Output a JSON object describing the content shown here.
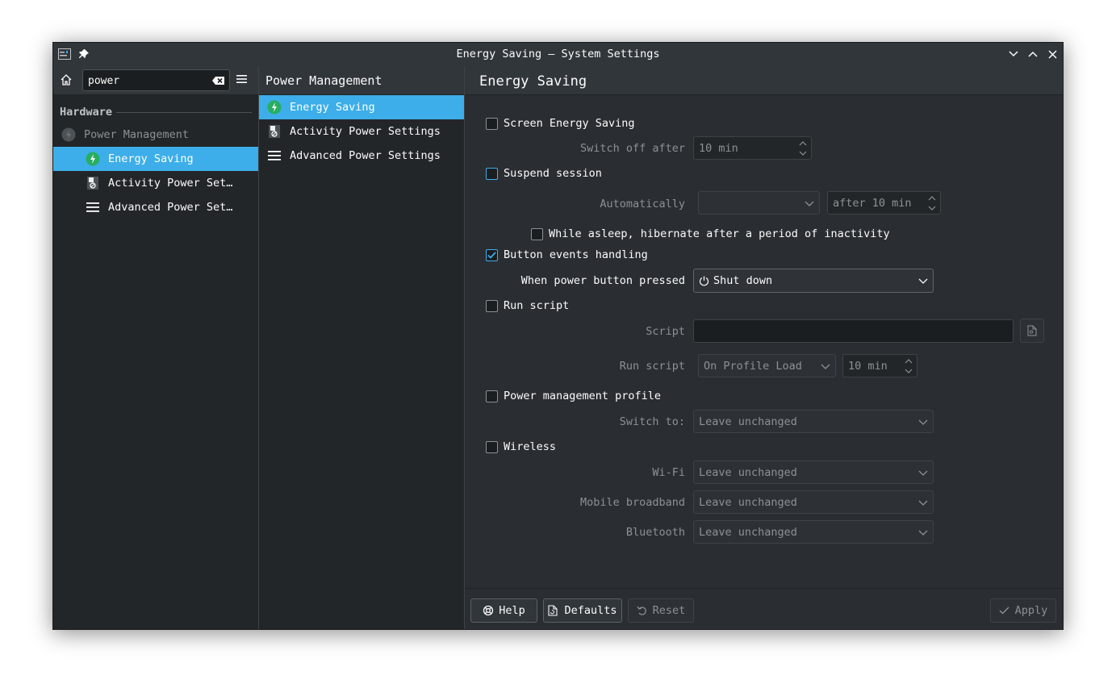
{
  "window": {
    "title": "Energy Saving — System Settings"
  },
  "sidebar": {
    "search_value": "power",
    "search_placeholder": "Search…",
    "section": "Hardware",
    "items": [
      {
        "label": "Power Management",
        "icon": "power-management-icon"
      },
      {
        "label": "Energy Saving",
        "icon": "energy-saving-icon",
        "selected": true
      },
      {
        "label": "Activity Power Set…",
        "icon": "activity-power-icon"
      },
      {
        "label": "Advanced Power Set…",
        "icon": "advanced-power-icon"
      }
    ]
  },
  "middle": {
    "title": "Power Management",
    "items": [
      {
        "label": "Energy Saving",
        "selected": true
      },
      {
        "label": "Activity Power Settings"
      },
      {
        "label": "Advanced Power Settings"
      }
    ]
  },
  "content": {
    "title": "Energy Saving",
    "screen_energy_saving": {
      "label": "Screen Energy Saving",
      "checked": false,
      "switch_off_label": "Switch off after",
      "switch_off_value": "10 min"
    },
    "suspend_session": {
      "label": "Suspend session",
      "checked": false,
      "automatically_label": "Automatically",
      "automatically_value": "",
      "after_value": "after 10 min",
      "hibernate_label": "While asleep, hibernate after a period of inactivity"
    },
    "button_events": {
      "label": "Button events handling",
      "checked": true,
      "power_button_label": "When power button pressed",
      "power_button_value": "Shut down"
    },
    "run_script": {
      "label": "Run script",
      "checked": false,
      "script_label": "Script",
      "script_value": "",
      "run_label": "Run script",
      "run_value": "On Profile Load",
      "time_value": "10 min"
    },
    "pm_profile": {
      "label": "Power management profile",
      "checked": false,
      "switch_label": "Switch to:",
      "switch_value": "Leave unchanged"
    },
    "wireless": {
      "label": "Wireless",
      "checked": false,
      "wifi_label": "Wi-Fi",
      "wifi_value": "Leave unchanged",
      "mobile_label": "Mobile broadband",
      "mobile_value": "Leave unchanged",
      "bt_label": "Bluetooth",
      "bt_value": "Leave unchanged"
    }
  },
  "buttons": {
    "help": "Help",
    "defaults": "Defaults",
    "reset": "Reset",
    "apply": "Apply"
  },
  "colors": {
    "accent": "#3daee9",
    "window_bg": "#2a2e32",
    "sidebar_bg": "#232629"
  }
}
